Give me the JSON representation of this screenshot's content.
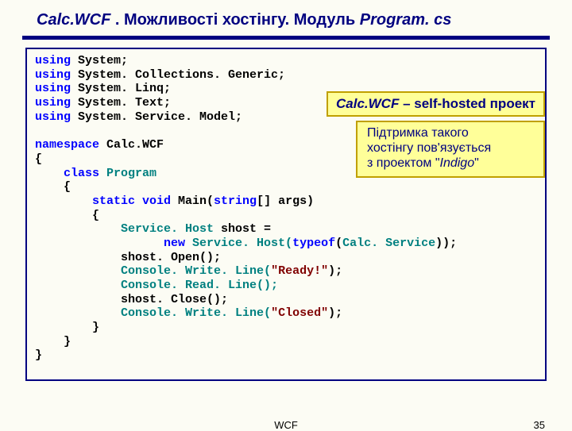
{
  "title": {
    "part1": "Calc.WCF",
    "part2": " . Можливості хостінгу. Модуль ",
    "part3": "Program. cs"
  },
  "callout1": {
    "em": "Calc.WCF",
    "mid": " – ",
    "strong": "self-hosted",
    "tail": " проект"
  },
  "callout2": {
    "line1": "Підтримка такого",
    "line2": "хостінгу пов'язується",
    "line3a": "з проектом \"",
    "line3b": "Indigo",
    "line3c": "\""
  },
  "code": {
    "u1a": "using",
    "u1b": " System;",
    "u2a": "using",
    "u2b": " System. Collections. Generic;",
    "u3a": "using",
    "u3b": " System. Linq;",
    "u4a": "using",
    "u4b": " System. Text;",
    "u5a": "using",
    "u5b": " System. Service. Model;",
    "ns1": "namespace",
    "ns2": " Calc.WCF",
    "ob": "{",
    "cl1": "    class",
    "cl2": " Program",
    "ob2": "    {",
    "m1": "        static void",
    "m2": " Main(",
    "m3": "string",
    "m4": "[] args)",
    "ob3": "        {",
    "l1a": "            Service. Host",
    "l1b": " shost =",
    "l2a": "                  new",
    "l2b": " Service. Host(",
    "l2c": "typeof",
    "l2d": "(",
    "l2e": "Calc. Service",
    "l2f": "));",
    "l3": "            shost. Open();",
    "l4a": "            Console. Write. Line(",
    "l4b": "\"Ready!\"",
    "l4c": ");",
    "l5": "            Console. Read. Line();",
    "l6": "            shost. Close();",
    "l7a": "            Console. Write. Line(",
    "l7b": "\"Closed\"",
    "l7c": ");",
    "cb3": "        }",
    "cb2": "    }",
    "cb": "}"
  },
  "footer": {
    "center": "WCF",
    "page": "35"
  }
}
